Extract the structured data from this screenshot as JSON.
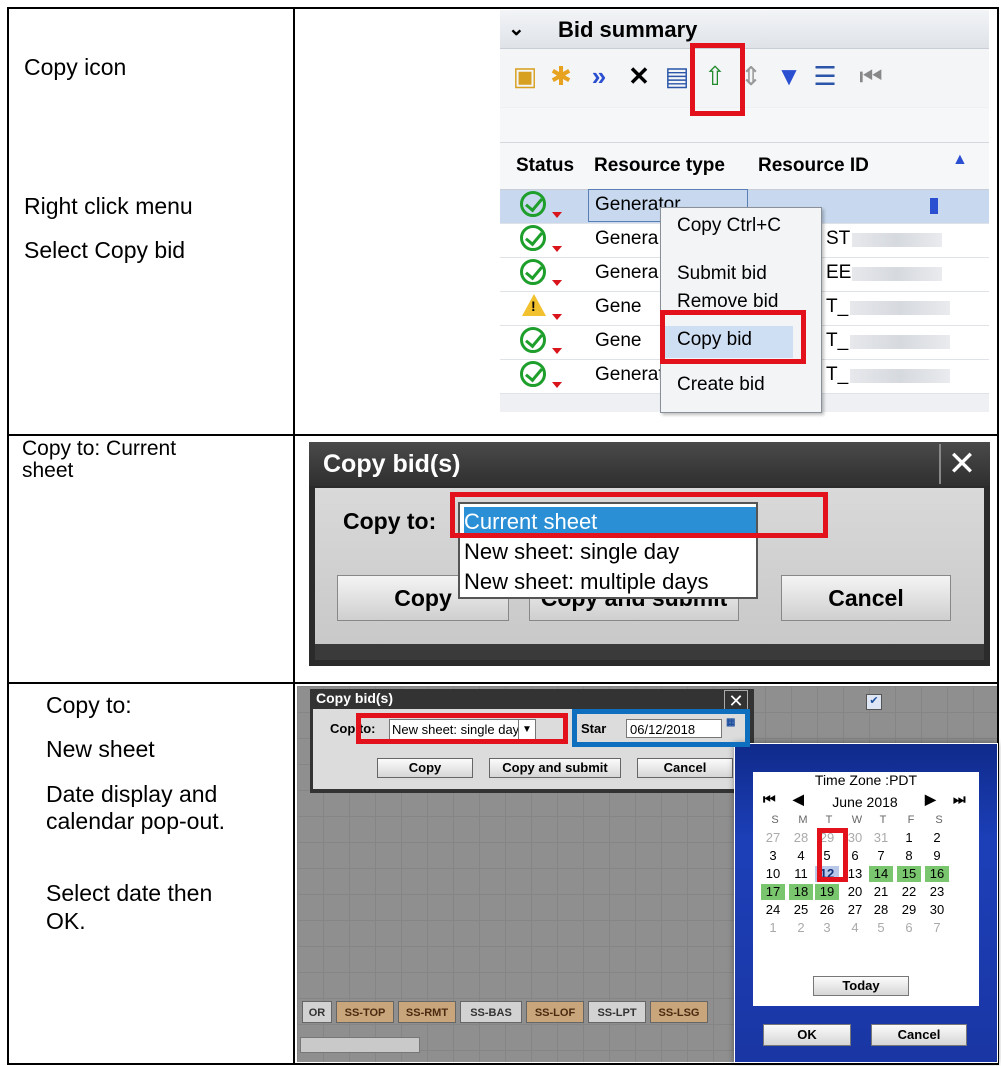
{
  "rows": [
    {
      "label_lines": [
        "Copy icon"
      ]
    },
    {
      "label_lines": [
        "Right click menu",
        "Select Copy bid"
      ]
    },
    {
      "label_lines": [
        "Copy to: Current",
        "sheet"
      ]
    },
    {
      "label_lines": [
        "Copy to:",
        "New sheet",
        "Date display and",
        "calendar pop-out.",
        "Select date then",
        "OK."
      ]
    }
  ],
  "bid_summary": {
    "title": "Bid summary",
    "columns": [
      "Status",
      "Resource type",
      "Resource ID"
    ],
    "rows": [
      {
        "status": "ok",
        "resource_type": "Generator",
        "resource_id": ""
      },
      {
        "status": "ok",
        "resource_type": "Genera",
        "resource_id": "ST"
      },
      {
        "status": "ok",
        "resource_type": "Genera",
        "resource_id": "EE"
      },
      {
        "status": "warning",
        "resource_type": "Gene",
        "resource_id": "T_"
      },
      {
        "status": "ok",
        "resource_type": "Gene",
        "resource_id": "T_"
      },
      {
        "status": "ok",
        "resource_type": "Generator",
        "resource_id": "T_"
      }
    ],
    "context_menu": [
      "Copy Ctrl+C",
      "Submit bid",
      "Remove bid",
      "Copy bid",
      "Create bid"
    ]
  },
  "copy_dialog": {
    "title": "Copy bid(s)",
    "copy_to_label": "Copy to:",
    "options": [
      "Current sheet",
      "New sheet: single day",
      "New sheet: multiple days"
    ],
    "buttons": [
      "Copy",
      "Copy and submit",
      "Cancel"
    ]
  },
  "copy_dialog_small": {
    "title": "Copy bid(s)",
    "copy_to_label": "Cop  to:",
    "selected_option": "New sheet: single day",
    "start_label": "Star",
    "start_date": "06/12/2018",
    "buttons": [
      "Copy",
      "Copy and submit",
      "Cancel"
    ]
  },
  "calendar": {
    "time_zone": "Time Zone :PDT",
    "month": "June 2018",
    "dow": [
      "S",
      "M",
      "T",
      "W",
      "T",
      "F",
      "S"
    ],
    "weeks": [
      [
        "27",
        "28",
        "29",
        "30",
        "31",
        "1",
        "2"
      ],
      [
        "3",
        "4",
        "5",
        "6",
        "7",
        "8",
        "9"
      ],
      [
        "10",
        "11",
        "12",
        "13",
        "14",
        "15",
        "16"
      ],
      [
        "17",
        "18",
        "19",
        "20",
        "21",
        "22",
        "23"
      ],
      [
        "24",
        "25",
        "26",
        "27",
        "28",
        "29",
        "30"
      ],
      [
        "1",
        "2",
        "3",
        "4",
        "5",
        "6",
        "7"
      ]
    ],
    "today_button": "Today",
    "ok_button": "OK",
    "cancel_button": "Cancel"
  },
  "sheet_tabs": [
    "OR",
    "SS-TOP",
    "SS-RMT",
    "SS-BAS",
    "SS-LOF",
    "SS-LPT",
    "SS-LSG"
  ],
  "colors": {
    "highlight_red": "#e3111b",
    "highlight_blue": "#0e6fbf",
    "calendar_green": "#7ac66f"
  }
}
